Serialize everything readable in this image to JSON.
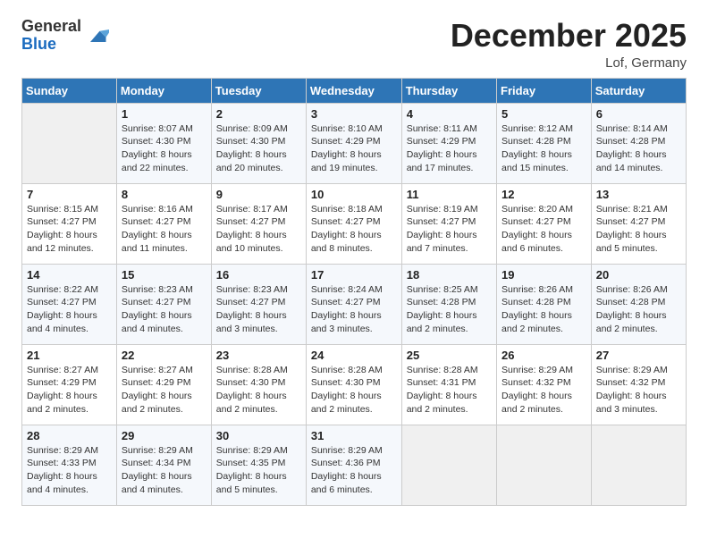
{
  "header": {
    "logo_general": "General",
    "logo_blue": "Blue",
    "month_title": "December 2025",
    "location": "Lof, Germany"
  },
  "columns": [
    "Sunday",
    "Monday",
    "Tuesday",
    "Wednesday",
    "Thursday",
    "Friday",
    "Saturday"
  ],
  "weeks": [
    [
      {
        "day": "",
        "info": ""
      },
      {
        "day": "1",
        "info": "Sunrise: 8:07 AM\nSunset: 4:30 PM\nDaylight: 8 hours\nand 22 minutes."
      },
      {
        "day": "2",
        "info": "Sunrise: 8:09 AM\nSunset: 4:30 PM\nDaylight: 8 hours\nand 20 minutes."
      },
      {
        "day": "3",
        "info": "Sunrise: 8:10 AM\nSunset: 4:29 PM\nDaylight: 8 hours\nand 19 minutes."
      },
      {
        "day": "4",
        "info": "Sunrise: 8:11 AM\nSunset: 4:29 PM\nDaylight: 8 hours\nand 17 minutes."
      },
      {
        "day": "5",
        "info": "Sunrise: 8:12 AM\nSunset: 4:28 PM\nDaylight: 8 hours\nand 15 minutes."
      },
      {
        "day": "6",
        "info": "Sunrise: 8:14 AM\nSunset: 4:28 PM\nDaylight: 8 hours\nand 14 minutes."
      }
    ],
    [
      {
        "day": "7",
        "info": "Sunrise: 8:15 AM\nSunset: 4:27 PM\nDaylight: 8 hours\nand 12 minutes."
      },
      {
        "day": "8",
        "info": "Sunrise: 8:16 AM\nSunset: 4:27 PM\nDaylight: 8 hours\nand 11 minutes."
      },
      {
        "day": "9",
        "info": "Sunrise: 8:17 AM\nSunset: 4:27 PM\nDaylight: 8 hours\nand 10 minutes."
      },
      {
        "day": "10",
        "info": "Sunrise: 8:18 AM\nSunset: 4:27 PM\nDaylight: 8 hours\nand 8 minutes."
      },
      {
        "day": "11",
        "info": "Sunrise: 8:19 AM\nSunset: 4:27 PM\nDaylight: 8 hours\nand 7 minutes."
      },
      {
        "day": "12",
        "info": "Sunrise: 8:20 AM\nSunset: 4:27 PM\nDaylight: 8 hours\nand 6 minutes."
      },
      {
        "day": "13",
        "info": "Sunrise: 8:21 AM\nSunset: 4:27 PM\nDaylight: 8 hours\nand 5 minutes."
      }
    ],
    [
      {
        "day": "14",
        "info": "Sunrise: 8:22 AM\nSunset: 4:27 PM\nDaylight: 8 hours\nand 4 minutes."
      },
      {
        "day": "15",
        "info": "Sunrise: 8:23 AM\nSunset: 4:27 PM\nDaylight: 8 hours\nand 4 minutes."
      },
      {
        "day": "16",
        "info": "Sunrise: 8:23 AM\nSunset: 4:27 PM\nDaylight: 8 hours\nand 3 minutes."
      },
      {
        "day": "17",
        "info": "Sunrise: 8:24 AM\nSunset: 4:27 PM\nDaylight: 8 hours\nand 3 minutes."
      },
      {
        "day": "18",
        "info": "Sunrise: 8:25 AM\nSunset: 4:28 PM\nDaylight: 8 hours\nand 2 minutes."
      },
      {
        "day": "19",
        "info": "Sunrise: 8:26 AM\nSunset: 4:28 PM\nDaylight: 8 hours\nand 2 minutes."
      },
      {
        "day": "20",
        "info": "Sunrise: 8:26 AM\nSunset: 4:28 PM\nDaylight: 8 hours\nand 2 minutes."
      }
    ],
    [
      {
        "day": "21",
        "info": "Sunrise: 8:27 AM\nSunset: 4:29 PM\nDaylight: 8 hours\nand 2 minutes."
      },
      {
        "day": "22",
        "info": "Sunrise: 8:27 AM\nSunset: 4:29 PM\nDaylight: 8 hours\nand 2 minutes."
      },
      {
        "day": "23",
        "info": "Sunrise: 8:28 AM\nSunset: 4:30 PM\nDaylight: 8 hours\nand 2 minutes."
      },
      {
        "day": "24",
        "info": "Sunrise: 8:28 AM\nSunset: 4:30 PM\nDaylight: 8 hours\nand 2 minutes."
      },
      {
        "day": "25",
        "info": "Sunrise: 8:28 AM\nSunset: 4:31 PM\nDaylight: 8 hours\nand 2 minutes."
      },
      {
        "day": "26",
        "info": "Sunrise: 8:29 AM\nSunset: 4:32 PM\nDaylight: 8 hours\nand 2 minutes."
      },
      {
        "day": "27",
        "info": "Sunrise: 8:29 AM\nSunset: 4:32 PM\nDaylight: 8 hours\nand 3 minutes."
      }
    ],
    [
      {
        "day": "28",
        "info": "Sunrise: 8:29 AM\nSunset: 4:33 PM\nDaylight: 8 hours\nand 4 minutes."
      },
      {
        "day": "29",
        "info": "Sunrise: 8:29 AM\nSunset: 4:34 PM\nDaylight: 8 hours\nand 4 minutes."
      },
      {
        "day": "30",
        "info": "Sunrise: 8:29 AM\nSunset: 4:35 PM\nDaylight: 8 hours\nand 5 minutes."
      },
      {
        "day": "31",
        "info": "Sunrise: 8:29 AM\nSunset: 4:36 PM\nDaylight: 8 hours\nand 6 minutes."
      },
      {
        "day": "",
        "info": ""
      },
      {
        "day": "",
        "info": ""
      },
      {
        "day": "",
        "info": ""
      }
    ]
  ]
}
